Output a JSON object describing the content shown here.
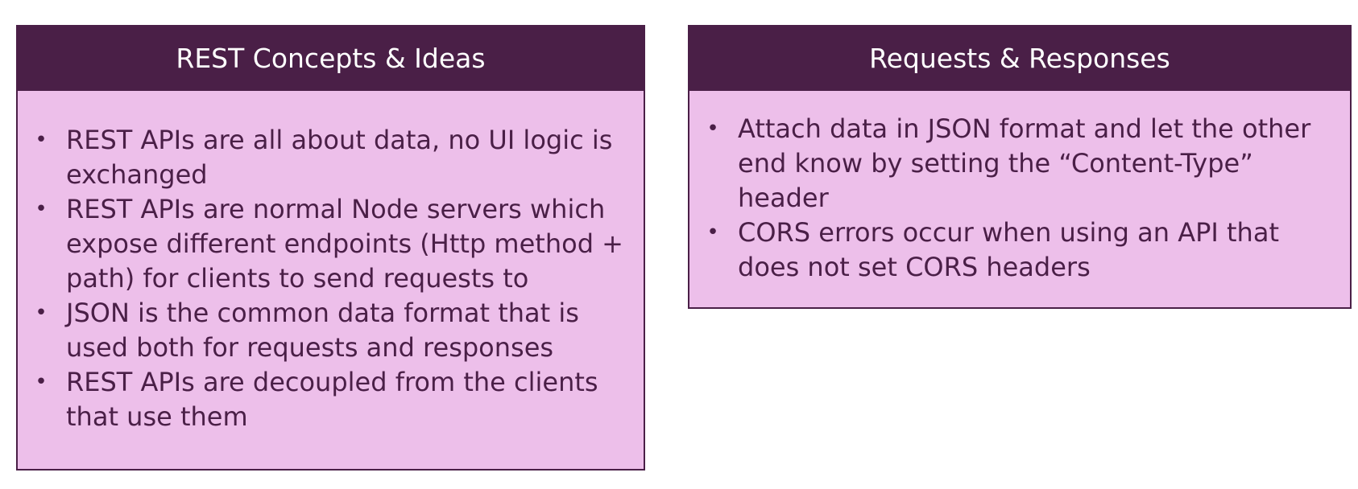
{
  "left_card": {
    "title": "REST Concepts & Ideas",
    "items": [
      "REST APIs are all about data, no UI logic is exchanged",
      "REST APIs are normal Node servers which expose different endpoints (Http method + path) for clients to send requests to",
      "JSON is the common data format that is used both for requests and responses",
      "REST APIs are decoupled from the clients that use them"
    ]
  },
  "right_card": {
    "title": "Requests & Responses",
    "items": [
      "Attach data in JSON format and let the other end know by setting the “Content-Type” header",
      "CORS errors occur when using an API that does not set CORS headers"
    ]
  },
  "colors": {
    "header_bg": "#4a1f47",
    "body_bg": "#edbfea",
    "text": "#4a1f47"
  }
}
